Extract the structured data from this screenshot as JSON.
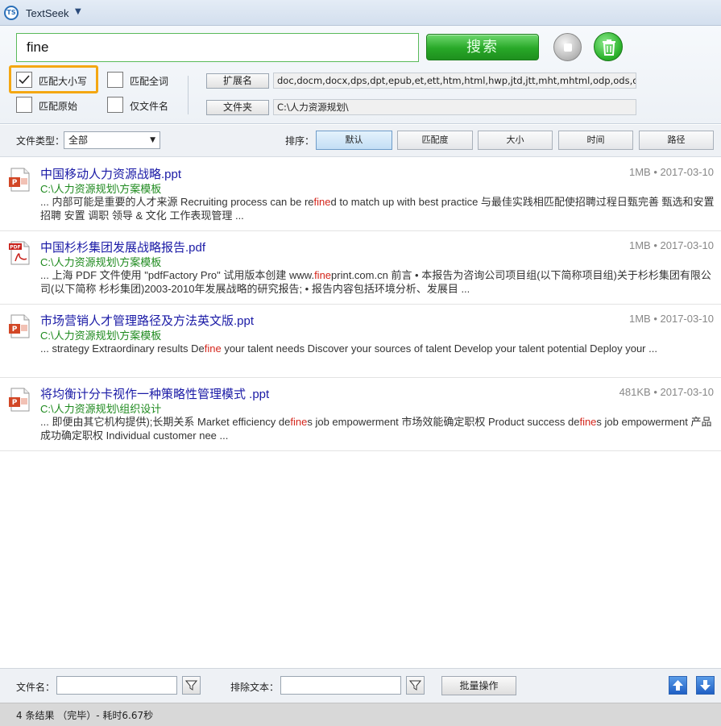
{
  "app": {
    "title": "TextSeek",
    "logo_text": "TS"
  },
  "search": {
    "query": "fine",
    "search_label": "搜索"
  },
  "options": {
    "match_case": {
      "label": "匹配大小写",
      "checked": true
    },
    "match_whole": {
      "label": "匹配全词",
      "checked": false
    },
    "match_raw": {
      "label": "匹配原始",
      "checked": false
    },
    "filename_only": {
      "label": "仅文件名",
      "checked": false
    }
  },
  "ext": {
    "label": "扩展名",
    "value": "doc,docm,docx,dps,dpt,epub,et,ett,htm,html,hwp,jtd,jtt,mht,mhtml,odp,ods,odt,ofd,p"
  },
  "folder": {
    "label": "文件夹",
    "value": "C:\\人力资源规划\\"
  },
  "filter": {
    "type_label": "文件类型：",
    "type_value": "全部",
    "sort_label": "排序：",
    "sort_buttons": [
      "默认",
      "匹配度",
      "大小",
      "时间",
      "路径"
    ],
    "active_sort": "默认"
  },
  "results": [
    {
      "icon": "ppt-file-icon",
      "title": "中国移动人力资源战略.ppt",
      "size": "1MB",
      "date": "2017-03-10",
      "path": "C:\\人力资源规划\\方案模板",
      "snippet_before": "... 内部可能是重要的人才来源 Recruiting process can be re",
      "snippet_hit": "fine",
      "snippet_after": "d to match up with best practice 与最佳实践相匹配使招聘过程日甄完善 甄选和安置 招聘 安置 调职 领导 & 文化 工作表现管理 ..."
    },
    {
      "icon": "pdf-file-icon",
      "title": "中国杉杉集团发展战略报告.pdf",
      "size": "1MB",
      "date": "2017-03-10",
      "path": "C:\\人力资源规划\\方案模板",
      "snippet_before": "... 上海 PDF 文件使用 \"pdfFactory Pro\" 试用版本创建 www.",
      "snippet_hit": "fine",
      "snippet_after": "print.com.cn 前言 • 本报告为咨询公司项目组(以下简称项目组)关于杉杉集团有限公司(以下简称 杉杉集团)2003-2010年发展战略的研究报告; • 报告内容包括环境分析、发展目 ..."
    },
    {
      "icon": "ppt-file-icon",
      "title": "市场营销人才管理路径及方法英文版.ppt",
      "size": "1MB",
      "date": "2017-03-10",
      "path": "C:\\人力资源规划\\方案模板",
      "snippet_before": "... strategy Extraordinary results De",
      "snippet_hit": "fine",
      "snippet_after": " your talent needs Discover your sources of talent Develop your talent potential Deploy your ..."
    },
    {
      "icon": "ppt-file-icon",
      "title": "将均衡计分卡视作一种策略性管理模式 .ppt",
      "size": "481KB",
      "date": "2017-03-10",
      "path": "C:\\人力资源规划\\组织设计",
      "snippet_parts": [
        "... 即便由其它机构提供);长期关系 Market efficiency de",
        "fine",
        "s job empowerment 市场效能确定职权 Product success de",
        "fine",
        "s job empowerment 产品成功确定职权 Individual customer nee ..."
      ]
    }
  ],
  "bottom": {
    "filename_label": "文件名：",
    "exclude_label": "排除文本：",
    "batch_label": "批量操作"
  },
  "status": {
    "text": "4 条结果 （完毕）- 耗时6.67秒"
  }
}
